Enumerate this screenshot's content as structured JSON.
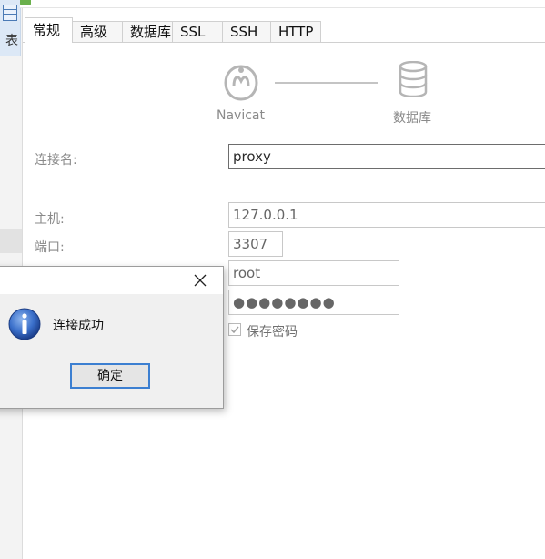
{
  "tabs": [
    {
      "label": "常规",
      "active": true
    },
    {
      "label": "高级"
    },
    {
      "label": "数据库"
    },
    {
      "label": "SSL"
    },
    {
      "label": "SSH"
    },
    {
      "label": "HTTP"
    }
  ],
  "header": {
    "left_label": "Navicat",
    "right_label": "数据库",
    "icons": [
      "navicat-logo-icon",
      "database-icon"
    ]
  },
  "form": {
    "connection_name": {
      "label": "连接名:",
      "value": "proxy"
    },
    "host": {
      "label": "主机:",
      "value": "127.0.0.1"
    },
    "port": {
      "label": "端口:",
      "value": "3307"
    },
    "username": {
      "value": "root"
    },
    "password": {
      "value": "●●●●●●●●"
    },
    "save_password": {
      "label": "保存密码",
      "checked": true
    }
  },
  "left_fragment": {
    "text": "表"
  },
  "message_box": {
    "message": "连接成功",
    "ok_label": "确定",
    "icons": [
      "info-icon",
      "close-icon"
    ]
  },
  "colors": {
    "accent": "#3c7fd1",
    "label_gray": "#8a8a8a",
    "info_blue": "#2a5db0"
  }
}
